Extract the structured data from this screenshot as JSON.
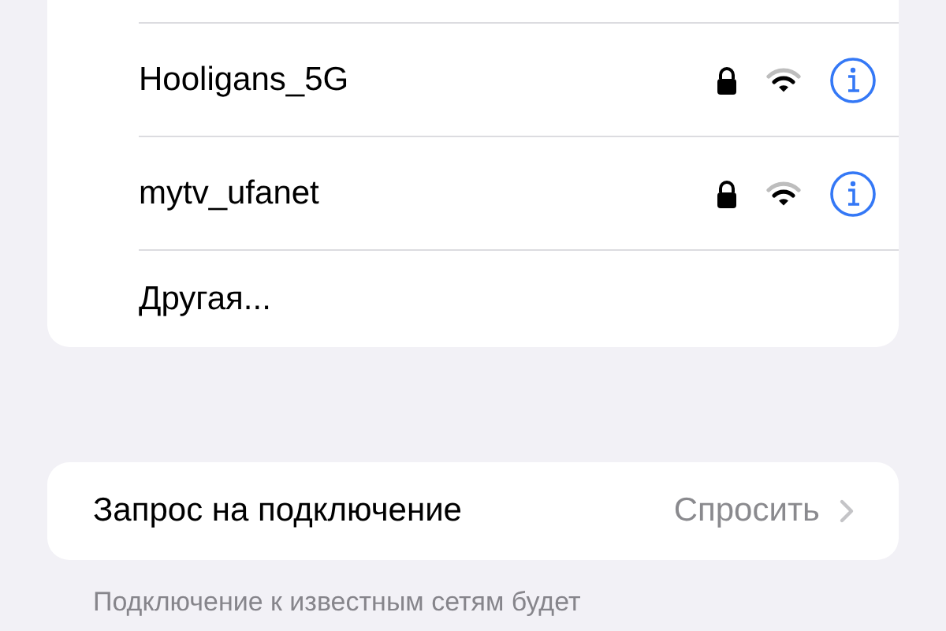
{
  "networks": [
    {
      "name": "Hooligans_5G",
      "locked": true
    },
    {
      "name": "mytv_ufanet",
      "locked": true
    }
  ],
  "other": "Другая...",
  "ask_to_join": {
    "label": "Запрос на подключение",
    "value": "Спросить"
  },
  "footer": "Подключение к известным сетям будет"
}
